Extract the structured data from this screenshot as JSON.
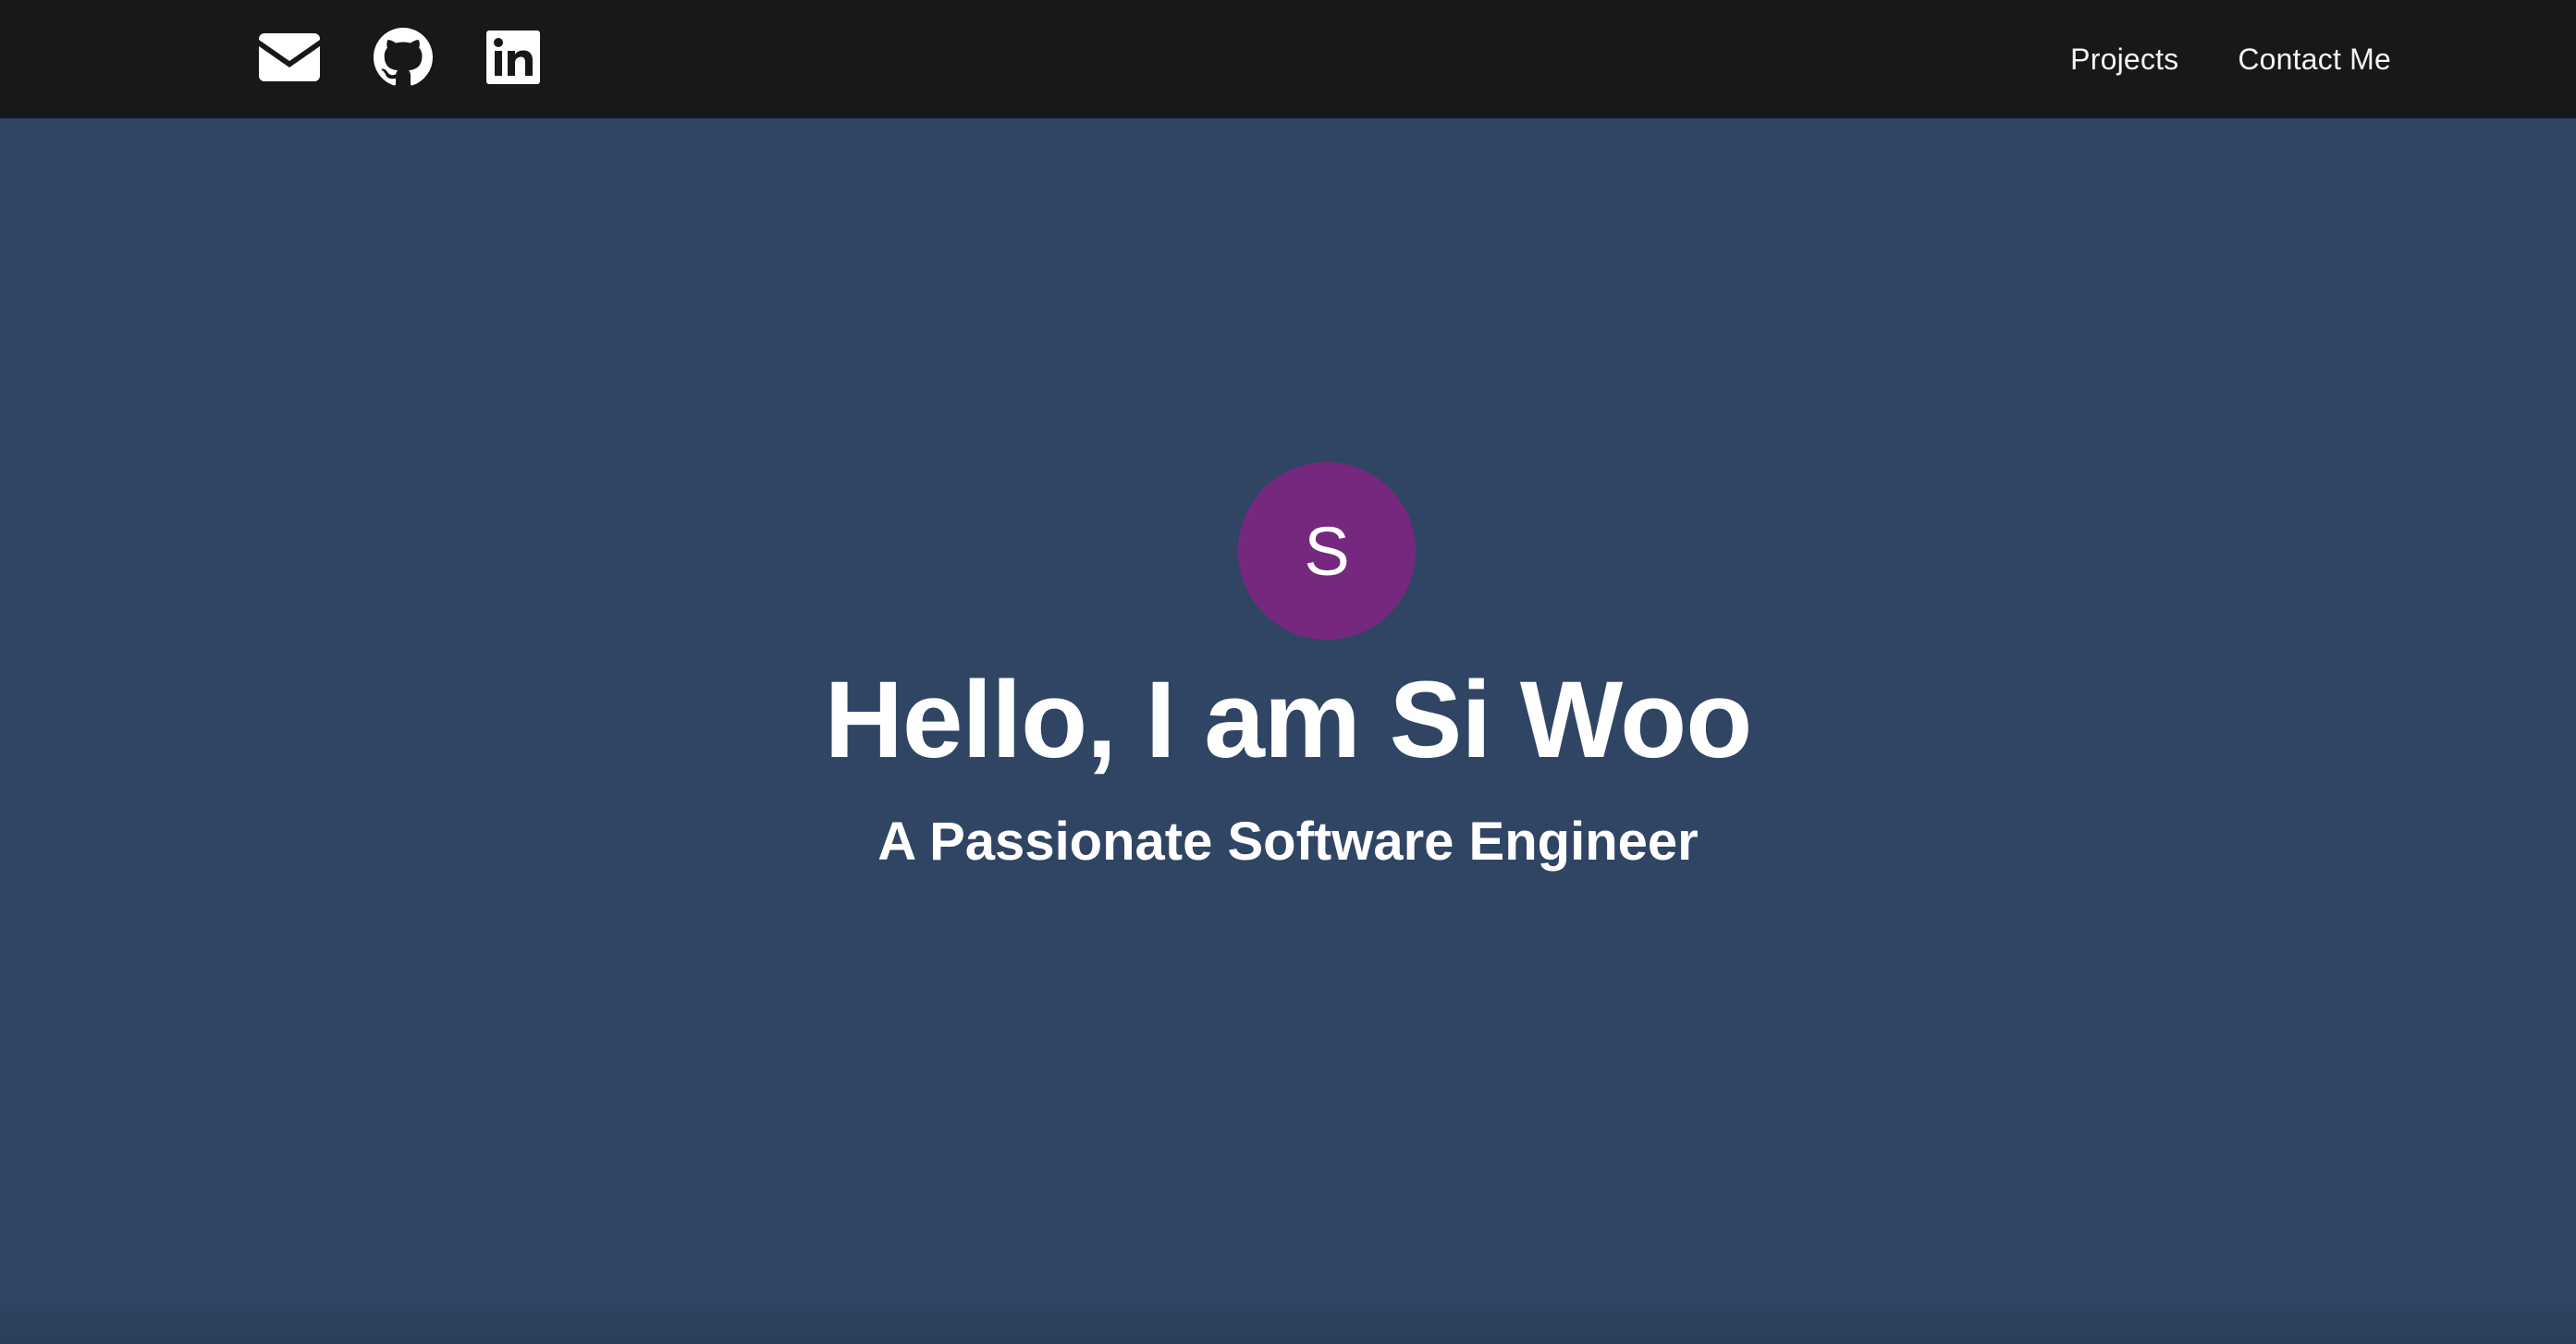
{
  "nav": {
    "icons": [
      {
        "name": "email-icon"
      },
      {
        "name": "github-icon"
      },
      {
        "name": "linkedin-icon"
      }
    ],
    "links": {
      "projects": "Projects",
      "contact": "Contact Me"
    }
  },
  "hero": {
    "avatar_initial": "S",
    "title": "Hello, I am Si Woo",
    "subtitle": "A Passionate Software Engineer"
  },
  "colors": {
    "navbar_bg": "#18181b",
    "hero_bg": "#304564",
    "avatar_bg": "#76287f",
    "text": "#ffffff"
  }
}
